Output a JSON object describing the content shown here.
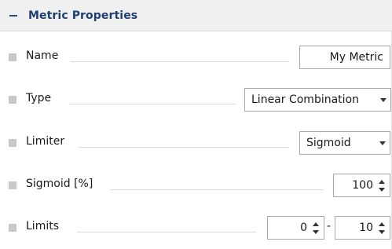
{
  "section": {
    "title": "Metric Properties",
    "collapse_glyph": "−",
    "toggle_icon": "minus-icon"
  },
  "properties": {
    "name": {
      "label": "Name",
      "value": "My Metric"
    },
    "type": {
      "label": "Type",
      "value": "Linear Combination"
    },
    "limiter": {
      "label": "Limiter",
      "value": "Sigmoid"
    },
    "sigmoid": {
      "label": "Sigmoid [%]",
      "value": "100"
    },
    "limits": {
      "label": "Limits",
      "min": "0",
      "separator": "-",
      "max": "10"
    }
  },
  "colors": {
    "header_bg": "#f0f0f0",
    "header_text": "#1f3f73",
    "bullet": "#c8c8c8",
    "leader": "#dddddd",
    "field_border": "#a8a8a8"
  }
}
